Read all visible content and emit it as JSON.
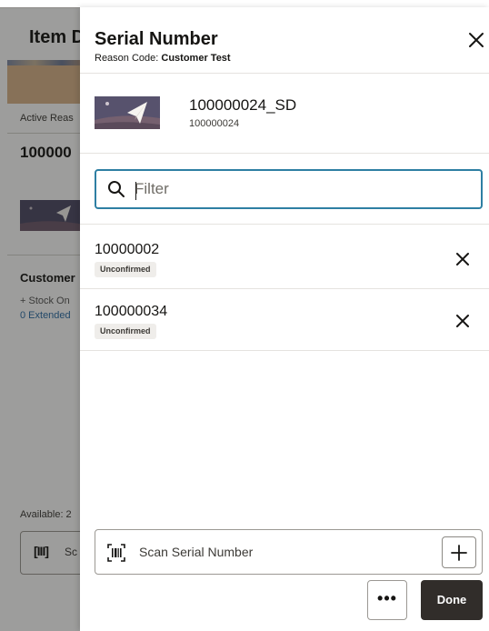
{
  "background": {
    "title": "Item D",
    "active_reason": "Active Reas",
    "item_number": "100000",
    "customer_label": "Customer",
    "stock_text": "+ Stock On",
    "extended_text": "0 Extended",
    "available_text": "Available:  2",
    "scan_label": "Sc"
  },
  "drawer": {
    "title": "Serial Number",
    "reason_label": "Reason Code:",
    "reason_value": "Customer Test",
    "close_icon": "close-icon",
    "product": {
      "name": "100000024_SD",
      "code": "100000024"
    },
    "filter": {
      "placeholder": "Filter",
      "icon": "search-icon"
    },
    "serials": [
      {
        "number": "10000002",
        "status": "Unconfirmed"
      },
      {
        "number": "100000034",
        "status": "Unconfirmed"
      }
    ],
    "scan": {
      "label": "Scan Serial Number",
      "icon": "barcode-icon",
      "add_icon": "plus-icon"
    },
    "footer": {
      "more_label": "•••",
      "done_label": "Done"
    }
  }
}
